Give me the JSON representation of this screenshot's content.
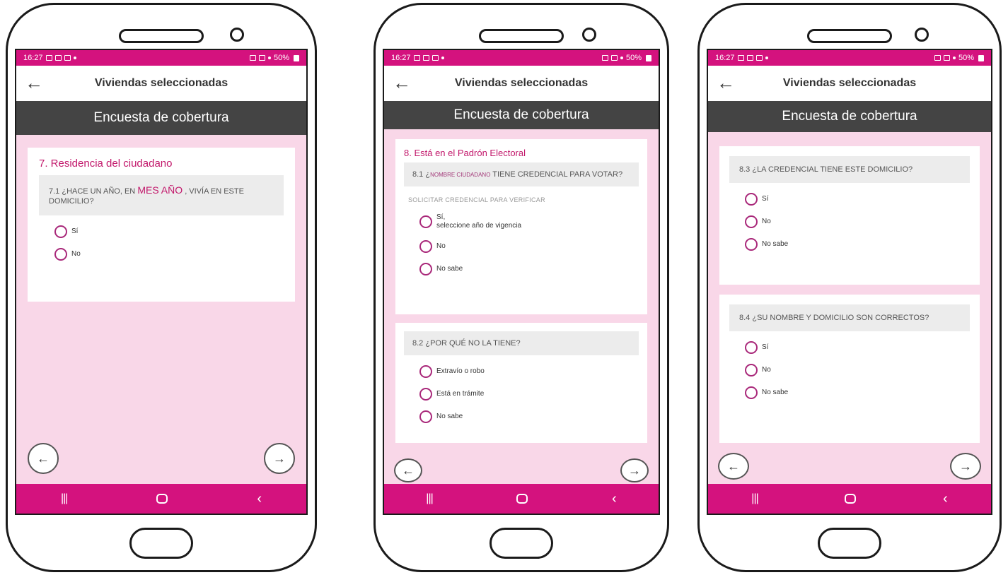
{
  "status_bar": {
    "time": "16:27",
    "battery": "50%"
  },
  "app_title": "Viviendas seleccionadas",
  "survey_title": "Encuesta de cobertura",
  "icons": {
    "back": "←",
    "prev": "←",
    "next": "→",
    "nav_recent": "|||",
    "nav_back": "‹"
  },
  "screen1": {
    "section_title": "7. Residencia del ciudadano",
    "q71": {
      "prefix": "7.1 ¿HACE UN AÑO, EN",
      "highlight": "MES AÑO",
      "suffix": ", VIVÍA EN ESTE DOMICILIO?",
      "options": [
        "Sí",
        "No"
      ]
    }
  },
  "screen2": {
    "section_title": "8. Está en el Padrón Electoral",
    "q81": {
      "prefix": "8.1 ¿",
      "placeholder": "NOMBRE CIUDADANO",
      "suffix": " TIENE CREDENCIAL PARA VOTAR?",
      "note": "SOLICITAR CREDENCIAL PARA VERIFICAR",
      "options": [
        "Sí,\nseleccione año de vigencia",
        "No",
        "No sabe"
      ]
    },
    "q82": {
      "text": "8.2 ¿POR QUÉ NO LA TIENE?",
      "options": [
        "Extravío o robo",
        "Está en trámite",
        "No sabe"
      ]
    }
  },
  "screen3": {
    "q83": {
      "text": "8.3 ¿LA CREDENCIAL TIENE ESTE DOMICILIO?",
      "options": [
        "Sí",
        "No",
        "No sabe"
      ]
    },
    "q84": {
      "text": "8.4 ¿SU NOMBRE Y DOMICILIO SON CORRECTOS?",
      "options": [
        "Sí",
        "No",
        "No sabe"
      ]
    }
  },
  "colors": {
    "brand": "#d4127e",
    "background": "#f9d7e8",
    "header_dark": "#444444",
    "section_title": "#c2186b"
  }
}
